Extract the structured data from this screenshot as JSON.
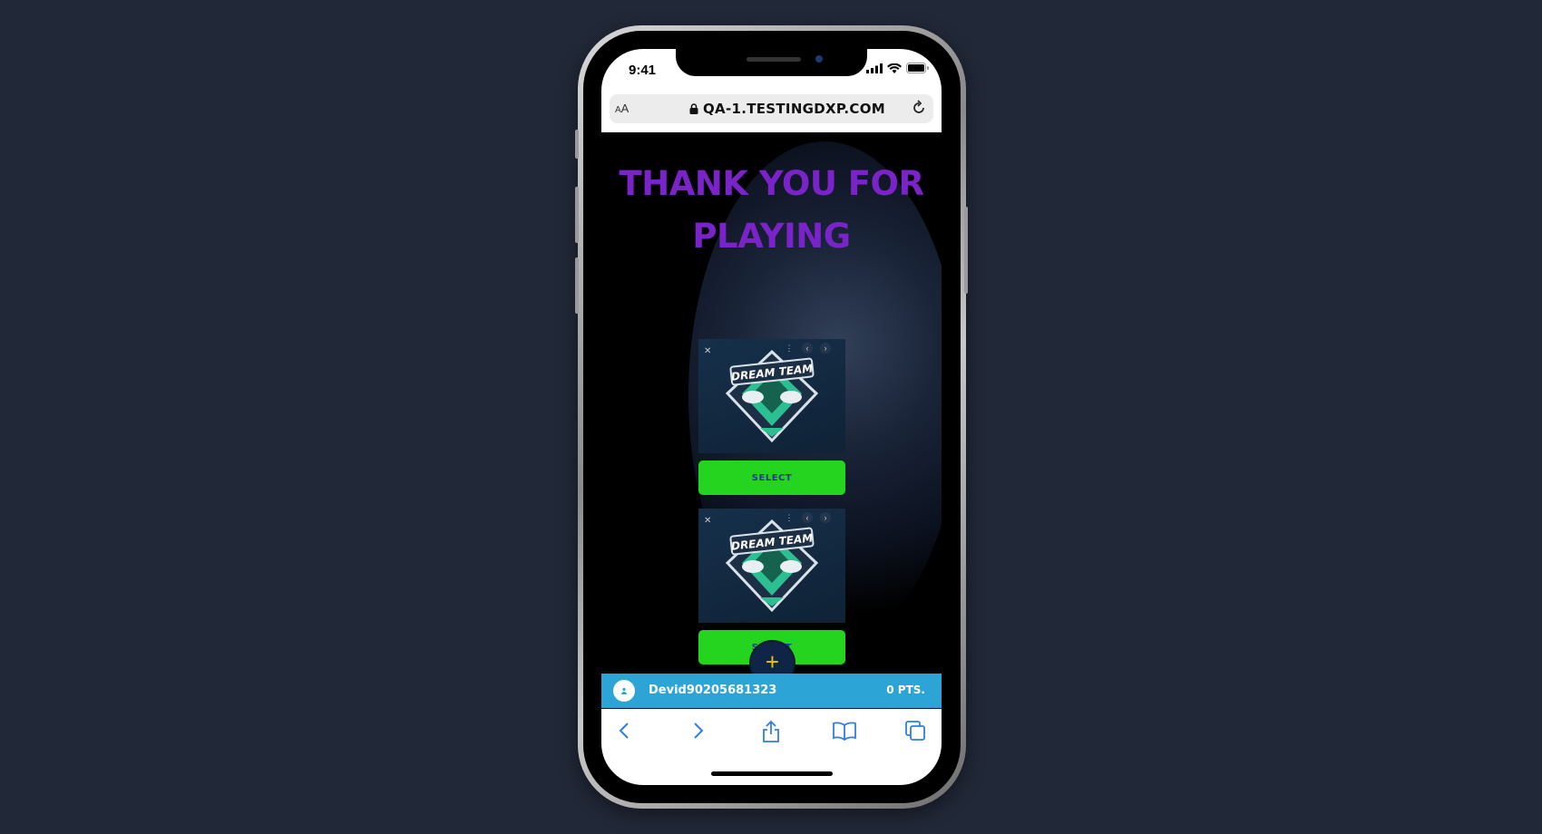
{
  "status": {
    "time": "9:41",
    "icons": [
      "signal-icon",
      "wifi-icon",
      "battery-icon"
    ]
  },
  "browser": {
    "aa_label": "AA",
    "url": "QA-1.TESTINGDXP.COM",
    "lock_icon": "lock-icon",
    "reload_icon": "reload-icon"
  },
  "main": {
    "title": "THANK YOU FOR PLAYING",
    "cards": [
      {
        "logo_text": "DREAM TEAM",
        "button_label": "SELECT"
      },
      {
        "logo_text": "DREAM TEAM",
        "button_label": "SELECT"
      }
    ],
    "fab_label": "+"
  },
  "userbar": {
    "username": "Devid90205681323",
    "points": "0 PTS."
  },
  "toolbar": {
    "items": [
      "back-icon",
      "forward-icon",
      "share-icon",
      "bookmarks-icon",
      "tabs-icon"
    ]
  },
  "colors": {
    "background": "#212837",
    "title": "#7a23c9",
    "select_button": "#25d41f",
    "userbar": "#2da4d6",
    "fab": "#0f2446"
  }
}
